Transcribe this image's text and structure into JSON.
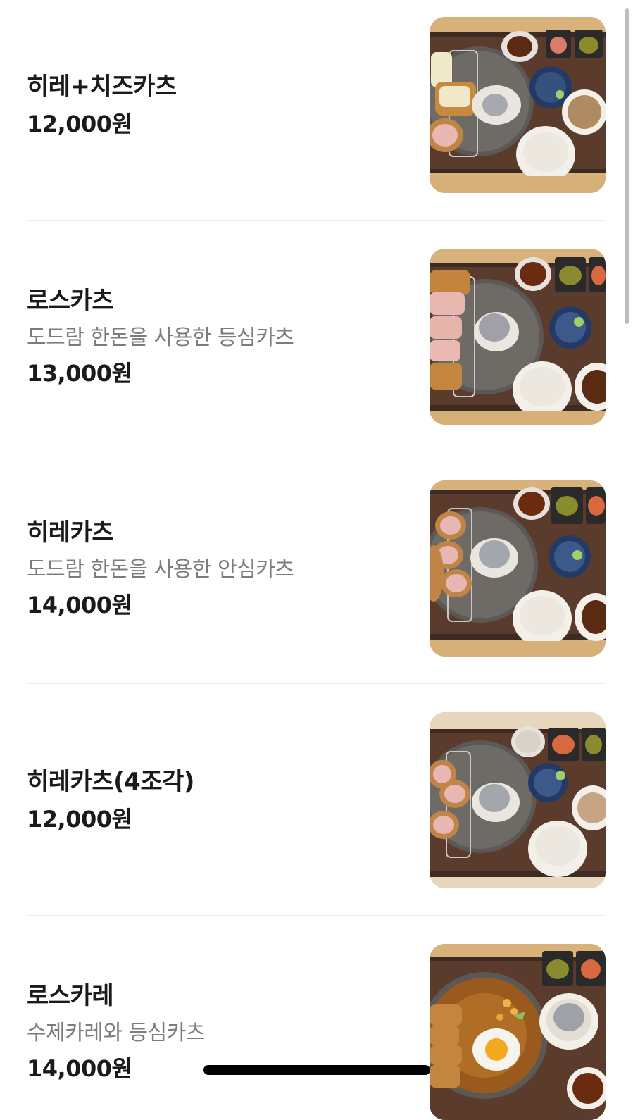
{
  "menu": {
    "items": [
      {
        "name": "히레+치즈카츠",
        "desc": "",
        "price": "12,000원",
        "image": "hire-cheese-katsu-photo"
      },
      {
        "name": "로스카츠",
        "desc": "도드람 한돈을 사용한 등심카츠",
        "price": "13,000원",
        "image": "rosu-katsu-photo"
      },
      {
        "name": "히레카츠",
        "desc": "도드람 한돈을 사용한 안심카츠",
        "price": "14,000원",
        "image": "hire-katsu-photo"
      },
      {
        "name": "히레카츠(4조각)",
        "desc": "",
        "price": "12,000원",
        "image": "hire-katsu-4pc-photo"
      },
      {
        "name": "로스카레",
        "desc": "수제카레와 등심카츠",
        "price": "14,000원",
        "image": "rosu-curry-photo"
      }
    ]
  },
  "colors": {
    "background": "#ffffff",
    "text": "#1a1a1a",
    "description": "#7c7c7c",
    "divider": "#ececec"
  }
}
